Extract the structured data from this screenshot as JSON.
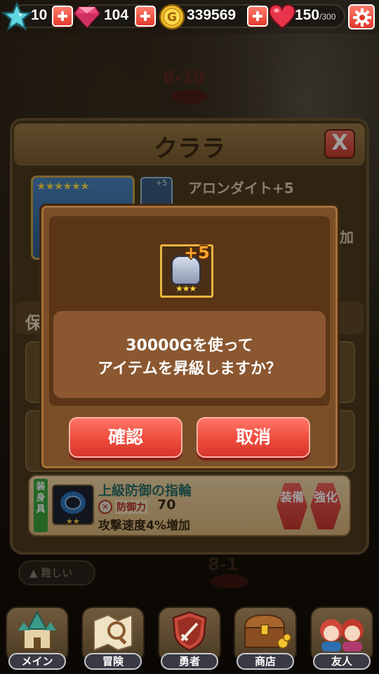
{
  "top_bar": {
    "stamina_value": "10",
    "gems_value": "104",
    "gold_value": "339569",
    "hearts_value": "150",
    "hearts_max": "/300"
  },
  "background": {
    "stage_top": "8-10",
    "stage_bottom": "8-1"
  },
  "panel": {
    "title": "クララ",
    "close_glyph": "X",
    "stars": "★★★★★★",
    "weapon_level": "+5",
    "weapon_name": "アロンダイト+5",
    "weapon_sub": "加",
    "section_label": "保"
  },
  "ring_item": {
    "tag": "装身具",
    "name": "上級防御の指輪",
    "stat_label": "防御力",
    "stat_value": "70",
    "effect": "攻撃速度4%増加",
    "stars": "★★",
    "equip_label": "装備",
    "upgrade_label": "強化"
  },
  "difficulty_label": "▲ 難しい",
  "dialog": {
    "item_level": "+5",
    "item_stars": "★★★",
    "message_line1": "30000Gを使って",
    "message_line2": "アイテムを昇級しますか？",
    "confirm_label": "確認",
    "cancel_label": "取消"
  },
  "bottom_nav": [
    {
      "label": "メイン"
    },
    {
      "label": "冒険"
    },
    {
      "label": "勇者"
    },
    {
      "label": "商店"
    },
    {
      "label": "友人"
    }
  ],
  "colors": {
    "dialog_bg": "#7a4f28",
    "button_red": "#ee4b3c",
    "gold": "#f2c230",
    "gem_pink": "#e94a7a"
  }
}
